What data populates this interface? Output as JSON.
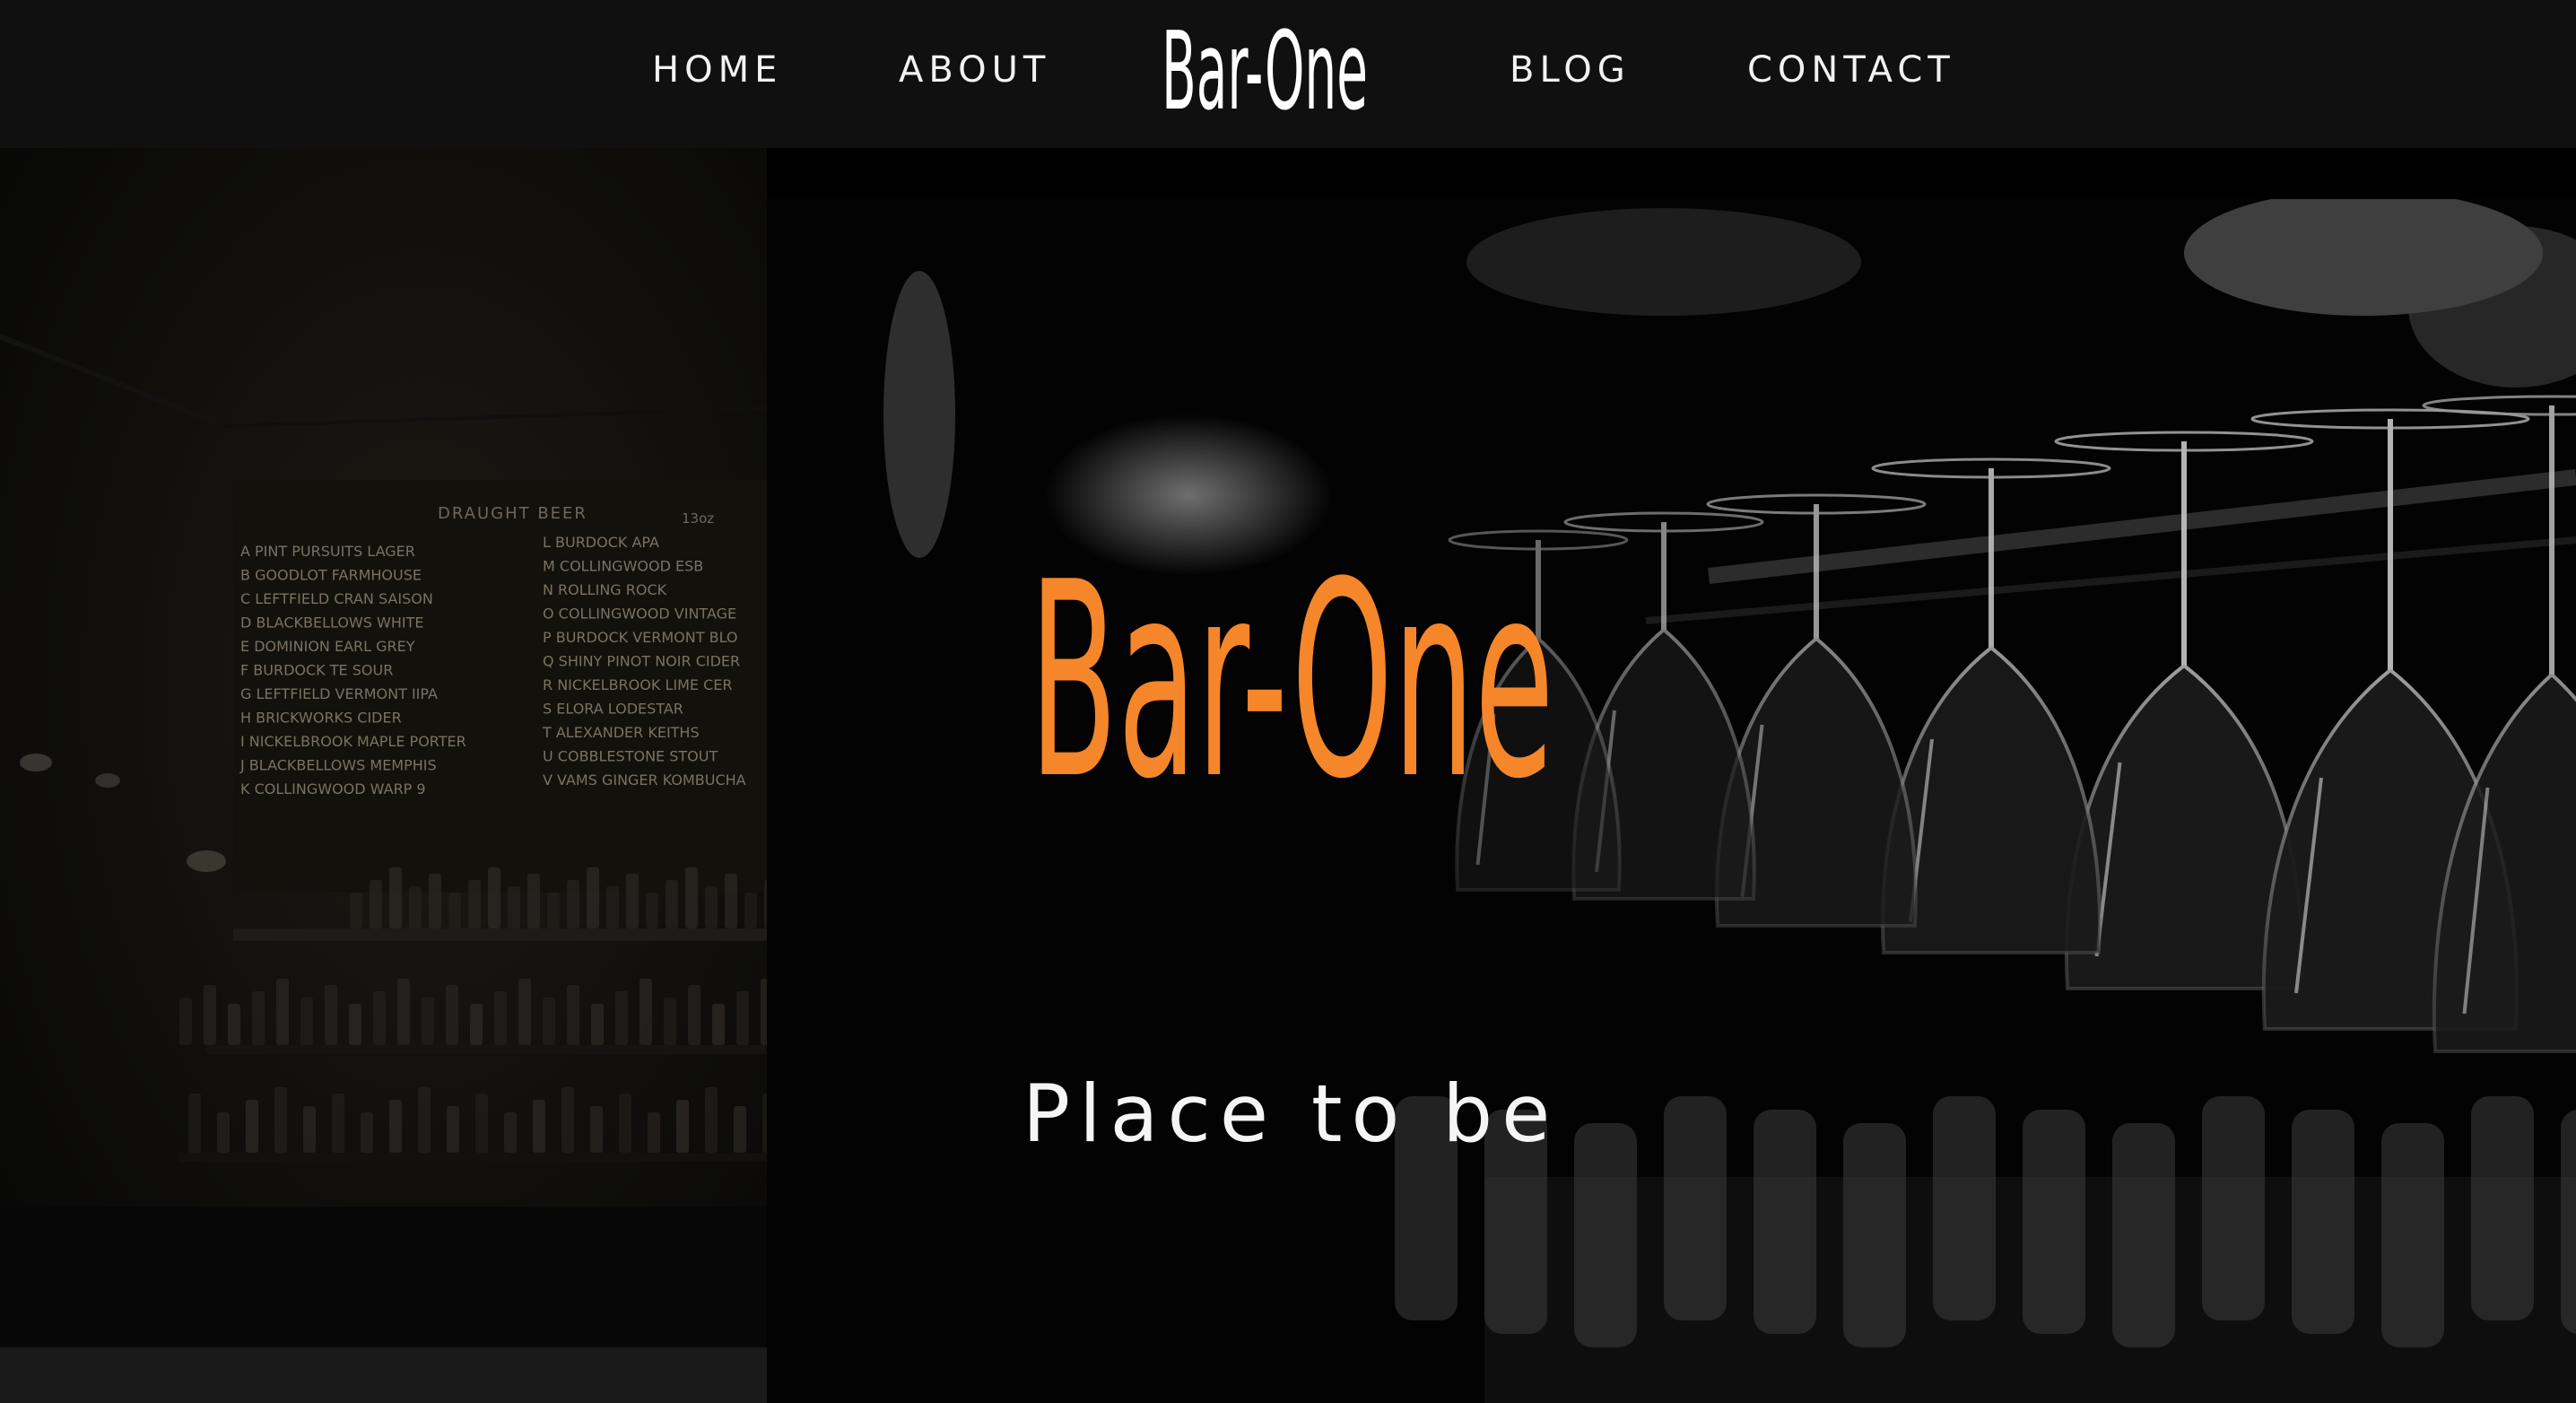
{
  "nav": {
    "links": {
      "home": "HOME",
      "about": "ABOUT",
      "blog": "BLOG",
      "contact": "CONTACT"
    },
    "logo_text": "Bar-One",
    "logo_color": "#ffffff"
  },
  "hero": {
    "title": "Bar-One",
    "subtitle": "Place to be",
    "title_color": "#f6862a",
    "left_photo": {
      "menu_heading": "DRAUGHT BEER",
      "menu_size": "13oz",
      "menu_col1": [
        "A PINT PURSUITS LAGER",
        "B GOODLOT FARMHOUSE",
        "C LEFTFIELD CRAN SAISON",
        "D BLACKBELLOWS WHITE",
        "E DOMINION EARL GREY",
        "F BURDOCK TE SOUR",
        "G LEFTFIELD VERMONT IIPA",
        "H BRICKWORKS CIDER",
        "I NICKELBROOK MAPLE PORTER",
        "J BLACKBELLOWS MEMPHIS",
        "K COLLINGWOOD WARP 9"
      ],
      "menu_col2": [
        "L BURDOCK APA",
        "M COLLINGWOOD ESB",
        "N ROLLING ROCK",
        "O COLLINGWOOD VINTAGE",
        "P BURDOCK VERMONT BLO",
        "Q SHINY PINOT NOIR CIDER",
        "R NICKELBROOK LIME CER",
        "S ELORA LODESTAR",
        "T ALEXANDER KEITHS",
        "U COBBLESTONE STOUT",
        "V VAMS GINGER KOMBUCHA"
      ]
    }
  },
  "colors": {
    "nav_background": "#101010",
    "page_background": "#000000",
    "accent": "#f6862a"
  }
}
